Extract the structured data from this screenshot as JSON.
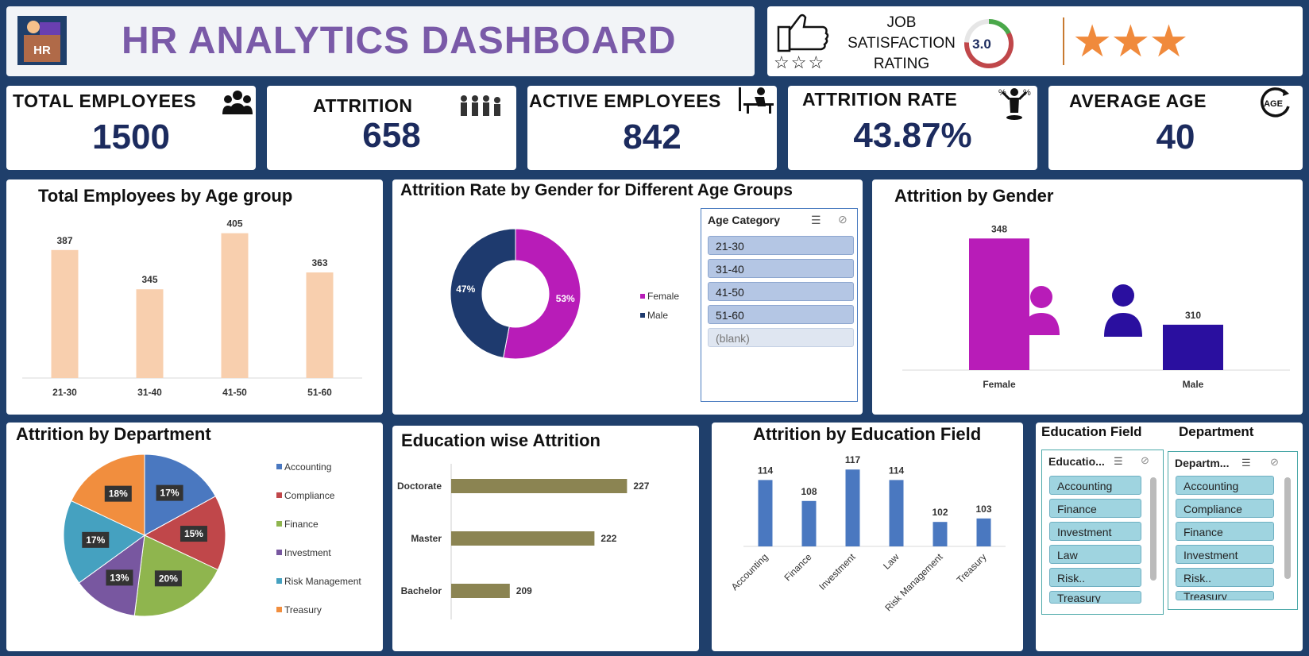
{
  "header": {
    "title": "HR ANALYTICS DASHBOARD",
    "logo_text": "HR"
  },
  "satisfaction": {
    "label_line1": "JOB",
    "label_line2": "SATISFACTION",
    "label_line3": "RATING",
    "value": "3.0",
    "rating": 3.0,
    "stars": 3,
    "max_stars": 5
  },
  "kpis": [
    {
      "title": "TOTAL EMPLOYEES",
      "value": "1500",
      "icon": "people-group-icon"
    },
    {
      "title": "ATTRITION",
      "value": "658",
      "icon": "people-leaving-icon"
    },
    {
      "title": "ACTIVE EMPLOYEES",
      "value": "842",
      "icon": "desk-worker-icon"
    },
    {
      "title": "ATTRITION RATE",
      "value": "43.87%",
      "icon": "percent-person-icon"
    },
    {
      "title": "AVERAGE AGE",
      "value": "40",
      "icon": "age-cycle-icon"
    }
  ],
  "slicer_age": {
    "header": "Age Category",
    "items": [
      "21-30",
      "31-40",
      "41-50",
      "51-60",
      "(blank)"
    ]
  },
  "slicer_education": {
    "caption": "Education Field",
    "header": "Educatio...",
    "items": [
      "Accounting",
      "Finance",
      "Investment",
      "Law",
      "Risk..",
      "Treasury"
    ]
  },
  "slicer_department": {
    "caption": "Department",
    "header": "Departm...",
    "items": [
      "Accounting",
      "Compliance",
      "Finance",
      "Investment",
      "Risk..",
      "Treasury"
    ]
  },
  "colors": {
    "age_bar": "#f8cfae",
    "female": "#b81cb8",
    "male": "#1e3a6e",
    "male_bar": "#2a0f9f",
    "edu_bar": "#8b8452",
    "field_bar": "#4a78c0",
    "dept": [
      "#4a78c0",
      "#c0474a",
      "#8fb54e",
      "#7857a0",
      "#45a1c0",
      "#f18e3e"
    ]
  },
  "chart_data": [
    {
      "id": "age",
      "type": "bar",
      "title": "Total Employees by Age group",
      "categories": [
        "21-30",
        "31-40",
        "41-50",
        "51-60"
      ],
      "values": [
        387,
        345,
        405,
        363
      ],
      "ylim": [
        250,
        420
      ]
    },
    {
      "id": "gender_donut",
      "type": "pie",
      "title": "Attrition Rate by Gender for Different Age Groups",
      "categories": [
        "Female",
        "Male"
      ],
      "values": [
        53,
        47
      ],
      "labels": [
        "53%",
        "47%"
      ],
      "legend": "right"
    },
    {
      "id": "gender_bar",
      "type": "bar",
      "title": "Attrition by Gender",
      "categories": [
        "Female",
        "Male"
      ],
      "values": [
        348,
        310
      ],
      "ylim": [
        290,
        360
      ]
    },
    {
      "id": "dept_pie",
      "type": "pie",
      "title": "Attrition by Department",
      "categories": [
        "Accounting",
        "Compliance",
        "Finance",
        "Investment",
        "Risk Management",
        "Treasury"
      ],
      "values": [
        17,
        15,
        20,
        13,
        17,
        18
      ],
      "labels": [
        "17%",
        "15%",
        "20%",
        "13%",
        "17%",
        "18%"
      ],
      "legend": "right"
    },
    {
      "id": "edu",
      "type": "bar",
      "orientation": "horizontal",
      "title": "Education wise Attrition",
      "categories": [
        "Doctorate",
        "Master",
        "Bachelor"
      ],
      "values": [
        227,
        222,
        209
      ],
      "xlim": [
        200,
        230
      ]
    },
    {
      "id": "field",
      "type": "bar",
      "title": "Attrition by Education Field",
      "categories": [
        "Accounting",
        "Finance",
        "Investment",
        "Law",
        "Risk Management",
        "Treasury"
      ],
      "values": [
        114,
        108,
        117,
        114,
        102,
        103
      ],
      "ylim": [
        95,
        120
      ]
    }
  ]
}
